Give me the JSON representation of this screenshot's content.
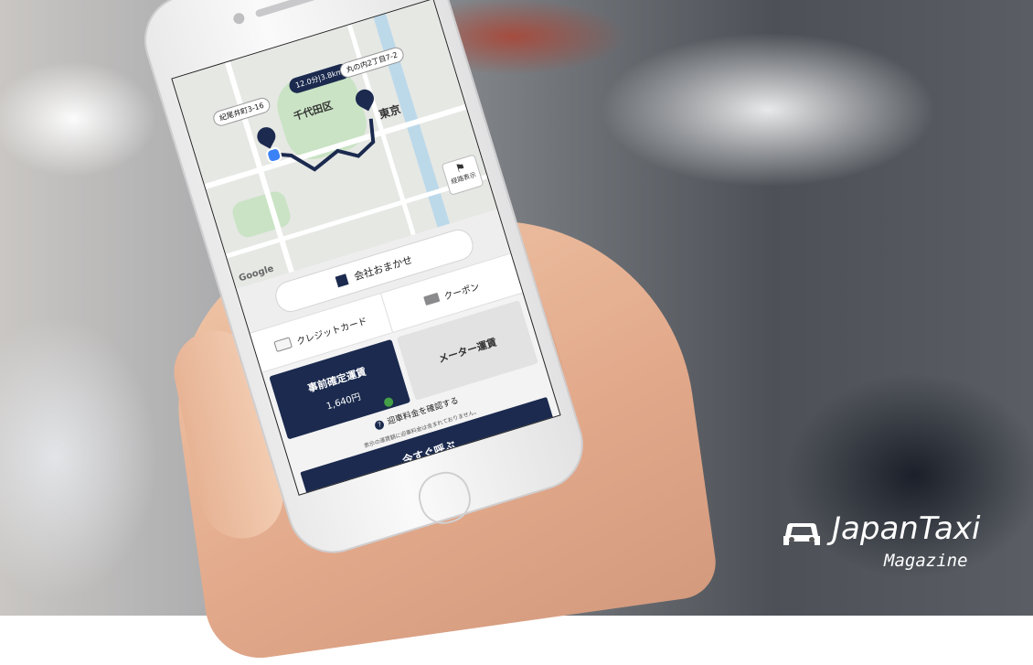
{
  "map": {
    "origin_label": "紀尾井町3-16",
    "eta_label": "12.0分|3.8km",
    "destination_label": "丸の内2丁目7-2",
    "district_label": "千代田区",
    "tokyo_label": "東京",
    "route_button_label": "経路表示",
    "attribution": "Google"
  },
  "company": {
    "label": "会社おまかせ",
    "icon": "building-icon"
  },
  "payment": {
    "card_label": "クレジットカード",
    "coupon_label": "クーポン"
  },
  "fare": {
    "fixed_title": "事前確定運賃",
    "fixed_price": "1,640円",
    "meter_title": "メーター運賃"
  },
  "pickup": {
    "label": "迎車料金を確認する",
    "note": "表示の運賃額に迎車料金は含まれておりません。"
  },
  "call_button": "今すぐ呼ぶ",
  "logo": {
    "brand": "JapanTaxi",
    "sub": "Magazine"
  },
  "colors": {
    "accent": "#1b2a4e",
    "logo": "#ffffff"
  }
}
